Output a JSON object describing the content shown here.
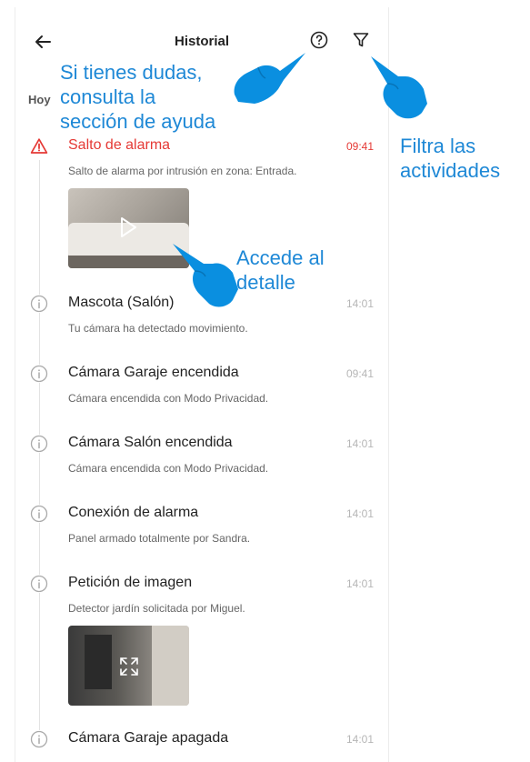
{
  "header": {
    "title": "Historial"
  },
  "day_label": "Hoy",
  "events": [
    {
      "title": "Salto de alarma",
      "time": "09:41",
      "description": "Salto de alarma por intrusión en zona: Entrada."
    },
    {
      "title": "Mascota (Salón)",
      "time": "14:01",
      "description": "Tu cámara ha detectado movimiento."
    },
    {
      "title": "Cámara Garaje encendida",
      "time": "09:41",
      "description": "Cámara encendida con Modo Privacidad."
    },
    {
      "title": "Cámara Salón encendida",
      "time": "14:01",
      "description": "Cámara encendida con Modo Privacidad."
    },
    {
      "title": "Conexión de alarma",
      "time": "14:01",
      "description": "Panel armado totalmente por Sandra."
    },
    {
      "title": "Petición de imagen",
      "time": "14:01",
      "description": "Detector jardín solicitada por Miguel."
    },
    {
      "title": "Cámara Garaje apagada",
      "time": "14:01"
    }
  ],
  "annotations": {
    "help_line1": "Si tienes dudas,",
    "help_line2": "consulta la",
    "help_line3": "sección de ayuda",
    "filter_line1": "Filtra las",
    "filter_line2": "actividades",
    "detail_line1": "Accede al",
    "detail_line2": "detalle"
  },
  "colors": {
    "alert": "#e53935",
    "annotation": "#1e88d6",
    "hand": "#0a8fe0"
  },
  "icons": [
    "back-arrow-icon",
    "help-icon",
    "filter-icon",
    "alert-triangle-icon",
    "info-icon",
    "play-icon",
    "expand-icon",
    "pointing-hand-icon"
  ]
}
